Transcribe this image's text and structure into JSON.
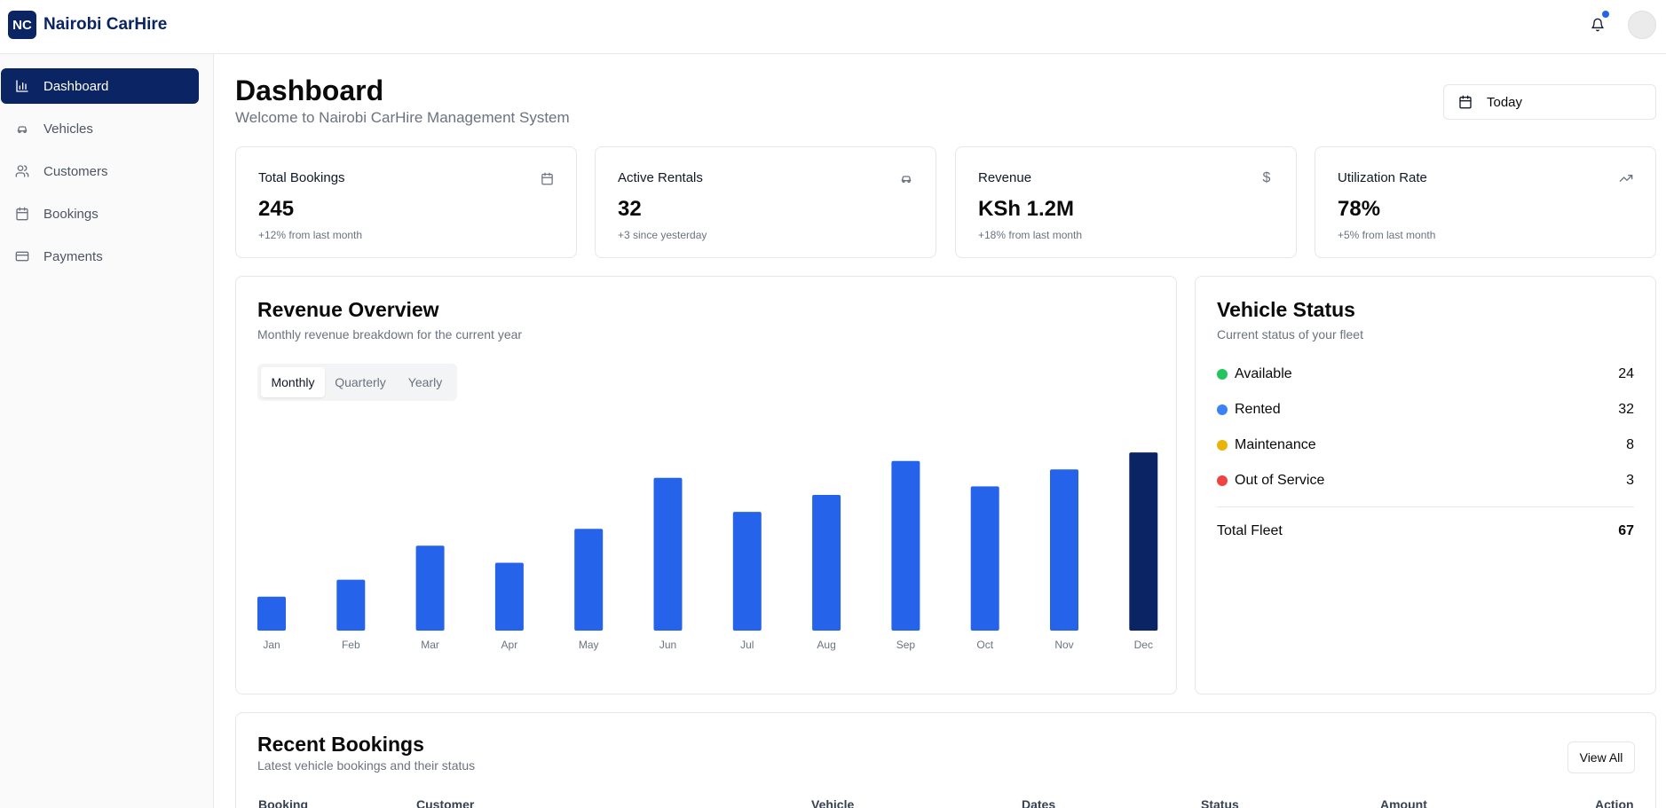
{
  "app": {
    "logo_initials": "NC",
    "name": "Nairobi CarHire"
  },
  "header": {
    "notification_icon": "bell-icon",
    "avatar_icon": "user-avatar"
  },
  "sidebar": {
    "items": [
      {
        "label": "Dashboard",
        "icon": "bar-chart-icon",
        "active": true
      },
      {
        "label": "Vehicles",
        "icon": "car-icon",
        "active": false
      },
      {
        "label": "Customers",
        "icon": "users-icon",
        "active": false
      },
      {
        "label": "Bookings",
        "icon": "calendar-icon",
        "active": false
      },
      {
        "label": "Payments",
        "icon": "credit-card-icon",
        "active": false
      }
    ]
  },
  "page": {
    "title": "Dashboard",
    "subtitle": "Welcome to Nairobi CarHire Management System",
    "date_filter": "Today"
  },
  "stats": [
    {
      "label": "Total Bookings",
      "value": "245",
      "change": "+12% from last month",
      "icon": "calendar-icon"
    },
    {
      "label": "Active Rentals",
      "value": "32",
      "change": "+3 since yesterday",
      "icon": "car-icon"
    },
    {
      "label": "Revenue",
      "value": "KSh 1.2M",
      "change": "+18% from last month",
      "icon": "dollar-icon",
      "icon_glyph": "$"
    },
    {
      "label": "Utilization Rate",
      "value": "78%",
      "change": "+5% from last month",
      "icon": "trending-up-icon"
    }
  ],
  "revenue": {
    "title": "Revenue Overview",
    "subtitle": "Monthly revenue breakdown for the current year",
    "tabs": [
      {
        "label": "Monthly",
        "active": true
      },
      {
        "label": "Quarterly",
        "active": false
      },
      {
        "label": "Yearly",
        "active": false
      }
    ]
  },
  "chart_data": {
    "type": "bar",
    "categories": [
      "Jan",
      "Feb",
      "Mar",
      "Apr",
      "May",
      "Jun",
      "Jul",
      "Aug",
      "Sep",
      "Oct",
      "Nov",
      "Dec"
    ],
    "values": [
      20,
      30,
      50,
      40,
      60,
      90,
      70,
      80,
      100,
      85,
      95,
      105
    ],
    "highlight_index": 11,
    "bar_color": "#2563eb",
    "highlight_color": "#0b2463",
    "ylim": [
      0,
      115
    ],
    "grid": false,
    "title": "",
    "xlabel": "",
    "ylabel": ""
  },
  "vehicle_status": {
    "title": "Vehicle Status",
    "subtitle": "Current status of your fleet",
    "items": [
      {
        "label": "Available",
        "count": "24",
        "color": "#22c55e"
      },
      {
        "label": "Rented",
        "count": "32",
        "color": "#3b82f6"
      },
      {
        "label": "Maintenance",
        "count": "8",
        "color": "#eab308"
      },
      {
        "label": "Out of Service",
        "count": "3",
        "color": "#ef4444"
      }
    ],
    "total_label": "Total Fleet",
    "total_value": "67"
  },
  "recent_bookings": {
    "title": "Recent Bookings",
    "subtitle": "Latest vehicle bookings and their status",
    "view_all": "View All",
    "columns": [
      "Booking",
      "Customer",
      "Vehicle",
      "Dates",
      "Status",
      "Amount",
      "Action"
    ]
  }
}
